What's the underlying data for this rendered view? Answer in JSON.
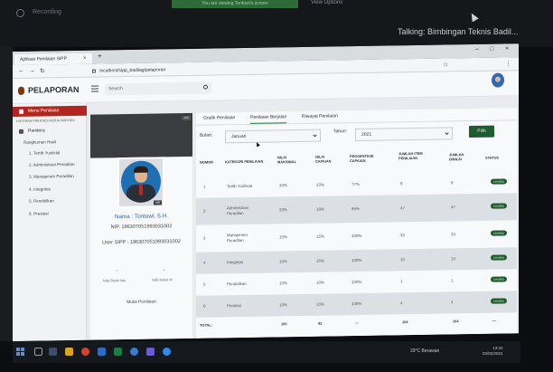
{
  "meeting": {
    "recording": "Recording",
    "banner": "You are viewing Tontowi's screen",
    "middle": "View Options",
    "talking": "Talking: Bimbingan Teknis Badil..."
  },
  "browser": {
    "tab_title": "Aplikasi Penilaian SIPP",
    "tab_close": "×",
    "new_tab": "+",
    "url": "localhost/sipp_badilag/pelaporan",
    "minimize": "–",
    "maximize": "□",
    "close": "×",
    "back": "←",
    "forward": "→",
    "reload": "↻",
    "star": "☆",
    "menu": "⋮"
  },
  "header": {
    "logo": "PELAPORAN",
    "search_placeholder": "Search"
  },
  "sidebar": {
    "active_item": "Menu Penilaian",
    "section_label": "LAPORAN PRESTASI KERJA INDIVIDU",
    "group": "Panitera",
    "items": [
      "Rangkuman Hasil",
      "1. Tertib Yustisial",
      "2. Administrasi Peradilan",
      "3. Manajemen Peradilan",
      "4. Integritas",
      "5. Pendidikan",
      "6. Prestasi"
    ]
  },
  "profile": {
    "badge": "100",
    "photo_badge": "edit",
    "name": "Nama : Tontowi, S.H.",
    "nip": "NIP. 196307051993031002",
    "user_sipp": "User SIPP : 196307051993031002",
    "dash_left": "–",
    "dash_right": "–",
    "label_left": "Nilai Bulan lalu",
    "label_right": "Nilai Bulan ini",
    "start_label": "Mulai Penilaian"
  },
  "tabs": [
    "Grafik Penilaian",
    "Penilaian Berjalan",
    "Riwayat Penilaian"
  ],
  "filters": {
    "bulan_label": "Bulan:",
    "bulan_value": "Januari",
    "tahun_label": "Tahun:",
    "tahun_value": "2021",
    "pilih_label": "Pilih"
  },
  "table": {
    "headers": [
      "NOMOR",
      "KATEGORI PENILAIAN",
      "NILAI MAKSIMAL",
      "NILAI CAPAIAN",
      "PROSENTASE CAPAIAN",
      "JUMLAH ITEM PENILAIAN",
      "JUMLAH DINILAI",
      "STATUS"
    ],
    "rows": [
      [
        "1",
        "Tertib Yustisial",
        "30%",
        "23%",
        "77%",
        "9",
        "9",
        "Lengkap"
      ],
      [
        "2",
        "Administrasi Peradilan",
        "20%",
        "19%",
        "95%",
        "47",
        "47",
        "Lengkap"
      ],
      [
        "3",
        "Manajemen Peradilan",
        "15%",
        "15%",
        "100%",
        "33",
        "33",
        "Lengkap"
      ],
      [
        "4",
        "Integritas",
        "15%",
        "15%",
        "100%",
        "10",
        "10",
        "Lengkap"
      ],
      [
        "5",
        "Pendidikan",
        "10%",
        "10%",
        "100%",
        "1",
        "1",
        "Lengkap"
      ],
      [
        "6",
        "Prestasi",
        "10%",
        "10%",
        "100%",
        "4",
        "4",
        "Lengkap"
      ]
    ],
    "total": [
      "TOTAL:",
      "100",
      "92",
      "---",
      "104",
      "104",
      "---"
    ]
  },
  "taskbar": {
    "weather": "29°C Berawan",
    "time": "13:22",
    "date": "02/02/2021"
  }
}
